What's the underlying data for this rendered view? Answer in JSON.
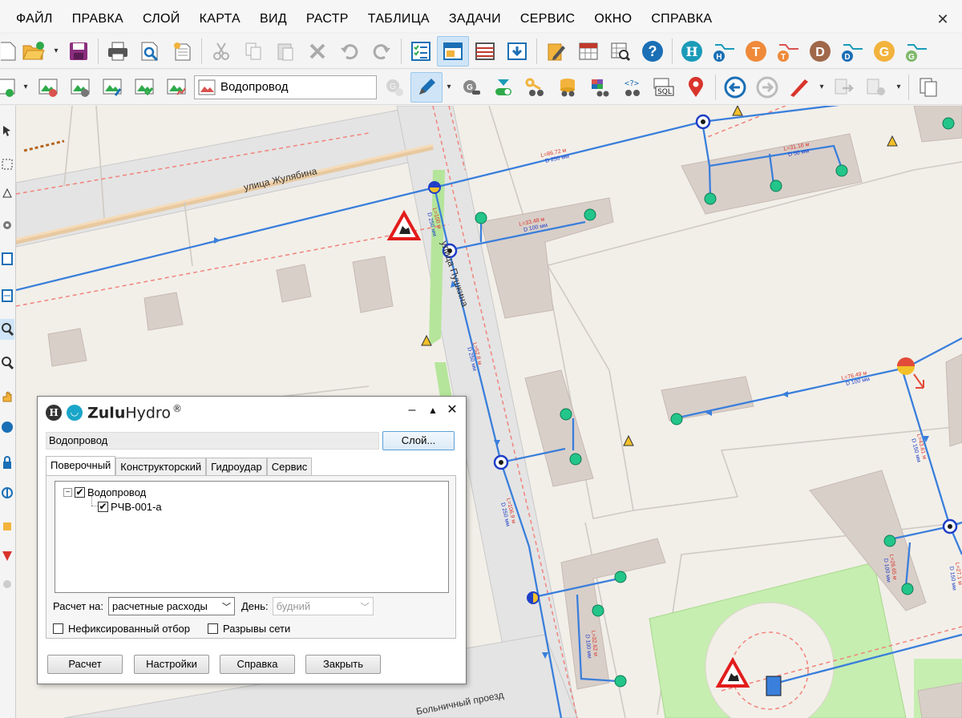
{
  "menu": [
    "ФАЙЛ",
    "ПРАВКА",
    "СЛОЙ",
    "КАРТА",
    "ВИД",
    "РАСТР",
    "ТАБЛИЦА",
    "ЗАДАЧИ",
    "СЕРВИС",
    "ОКНО",
    "СПРАВКА"
  ],
  "toolbar2": {
    "layer_combo_value": "Водопровод"
  },
  "map": {
    "streets": {
      "zhulyabina": "улица Жулябина",
      "pushkina": "улица Пушкина",
      "bolnichny": "Больничный проезд"
    },
    "pipe_labels": [
      {
        "length": "L=86.72 м",
        "diameter": "D 250 мм"
      },
      {
        "length": "L=31.16 м",
        "diameter": "D 50 мм"
      },
      {
        "length": "L=33.48 м",
        "diameter": "D 100 мм"
      },
      {
        "length": "L=76.49 м",
        "diameter": "D 100 мм"
      },
      {
        "length": "L=100 м",
        "diameter": "D 250 мм"
      },
      {
        "length": "L=52.8 м",
        "diameter": "D 250 мм"
      },
      {
        "length": "L=106.9 м",
        "diameter": "D 250 мм"
      },
      {
        "length": "L=43.61 м",
        "diameter": "D 150 мм"
      },
      {
        "length": "L=26.65 м",
        "diameter": "D 100 мм"
      },
      {
        "length": "L=32.62 м",
        "diameter": "D 100 мм"
      },
      {
        "length": "L=27.1 м",
        "diameter": "D 150 мм"
      }
    ],
    "colors": {
      "pipe": "#3a7fdb",
      "red_dash": "#f0837a",
      "consumer": "#23c58a",
      "building": "#d9cfc9",
      "road": "#e2e2e2",
      "park": "#c6eeb0"
    }
  },
  "dialog": {
    "brand_bold": "Zulu",
    "brand_light": "Hydro",
    "brand_reg": "®",
    "layer_name": "Водопровод",
    "layer_button": "Слой...",
    "tabs": [
      "Поверочный",
      "Конструкторский",
      "Гидроудар",
      "Сервис"
    ],
    "tree": {
      "root": "Водопровод",
      "child": "РЧВ-001-а"
    },
    "calc_label": "Расчет на:",
    "calc_value": "расчетные расходы",
    "day_label": "День:",
    "day_value": "будний",
    "check_unfixed": "Нефиксированный отбор",
    "check_breaks": "Разрывы сети",
    "buttons": {
      "calc": "Расчет",
      "settings": "Настройки",
      "help": "Справка",
      "close": "Закрыть"
    }
  }
}
